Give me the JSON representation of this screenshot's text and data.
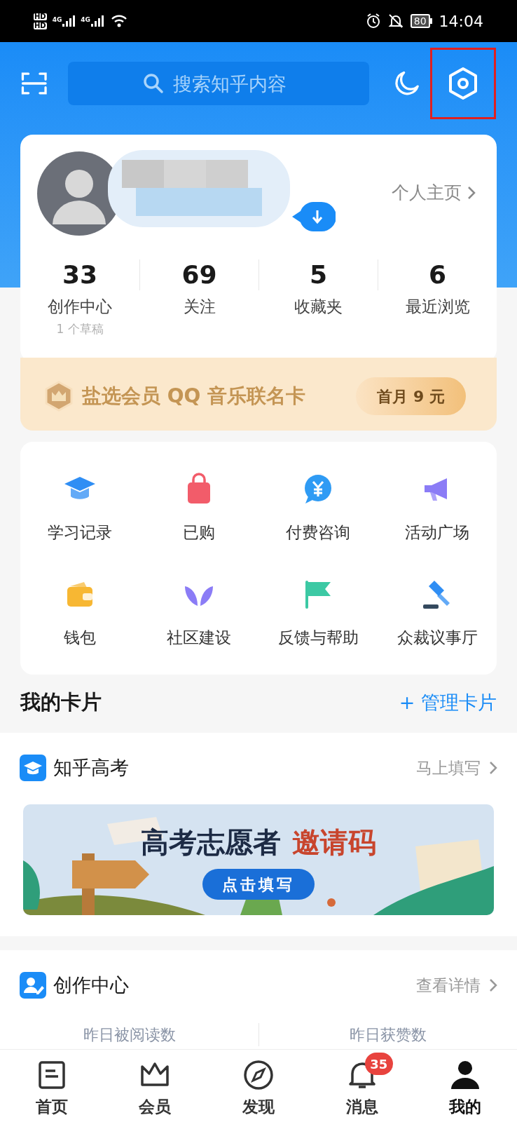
{
  "status_bar": {
    "sim_labels": [
      "HD",
      "HD"
    ],
    "network_labels": [
      "4G",
      "4G"
    ],
    "battery": "80",
    "time": "14:04"
  },
  "top_bar": {
    "search": {
      "placeholder": "搜索知乎内容"
    },
    "settings_highlighted": true
  },
  "profile": {
    "homepage_link": "个人主页",
    "stats": [
      {
        "value": "33",
        "label": "创作中心",
        "note": "1 个草稿"
      },
      {
        "value": "69",
        "label": "关注"
      },
      {
        "value": "5",
        "label": "收藏夹"
      },
      {
        "value": "6",
        "label": "最近浏览"
      }
    ]
  },
  "vip_banner": {
    "text": "盐选会员 QQ 音乐联名卡",
    "button": "首月 9 元"
  },
  "shortcuts": [
    {
      "kind": "cap",
      "label": "学习记录",
      "color": "#2f8ef4"
    },
    {
      "kind": "bag",
      "label": "已购",
      "color": "#f25c6a"
    },
    {
      "kind": "coin",
      "label": "付费咨询",
      "color": "#2f9bf4"
    },
    {
      "kind": "megaphone",
      "label": "活动广场",
      "color": "#8b7cf6"
    },
    {
      "kind": "wallet",
      "label": "钱包",
      "color": "#f7b733"
    },
    {
      "kind": "sprout",
      "label": "社区建设",
      "color": "#8b7cf6"
    },
    {
      "kind": "flag",
      "label": "反馈与帮助",
      "color": "#3cc9a4"
    },
    {
      "kind": "gavel",
      "label": "众裁议事厅",
      "color": "#2f8ef4"
    }
  ],
  "my_cards": {
    "title": "我的卡片",
    "manage": "+ 管理卡片"
  },
  "cards": [
    {
      "kind": "gaokao",
      "title": "知乎高考",
      "action": "马上填写",
      "banner": {
        "headline": "高考志愿者",
        "highlight": "邀请码",
        "button": "点击填写"
      }
    },
    {
      "kind": "creator",
      "title": "创作中心",
      "action": "查看详情",
      "metrics": [
        "昨日被阅读数",
        "昨日获赞数"
      ]
    }
  ],
  "bottom_nav": [
    {
      "kind": "home",
      "label": "首页",
      "selected": false
    },
    {
      "kind": "crown",
      "label": "会员",
      "selected": false
    },
    {
      "kind": "compass",
      "label": "发现",
      "selected": false
    },
    {
      "kind": "bell",
      "label": "消息",
      "selected": false,
      "badge": "35"
    },
    {
      "kind": "person",
      "label": "我的",
      "selected": true
    }
  ]
}
